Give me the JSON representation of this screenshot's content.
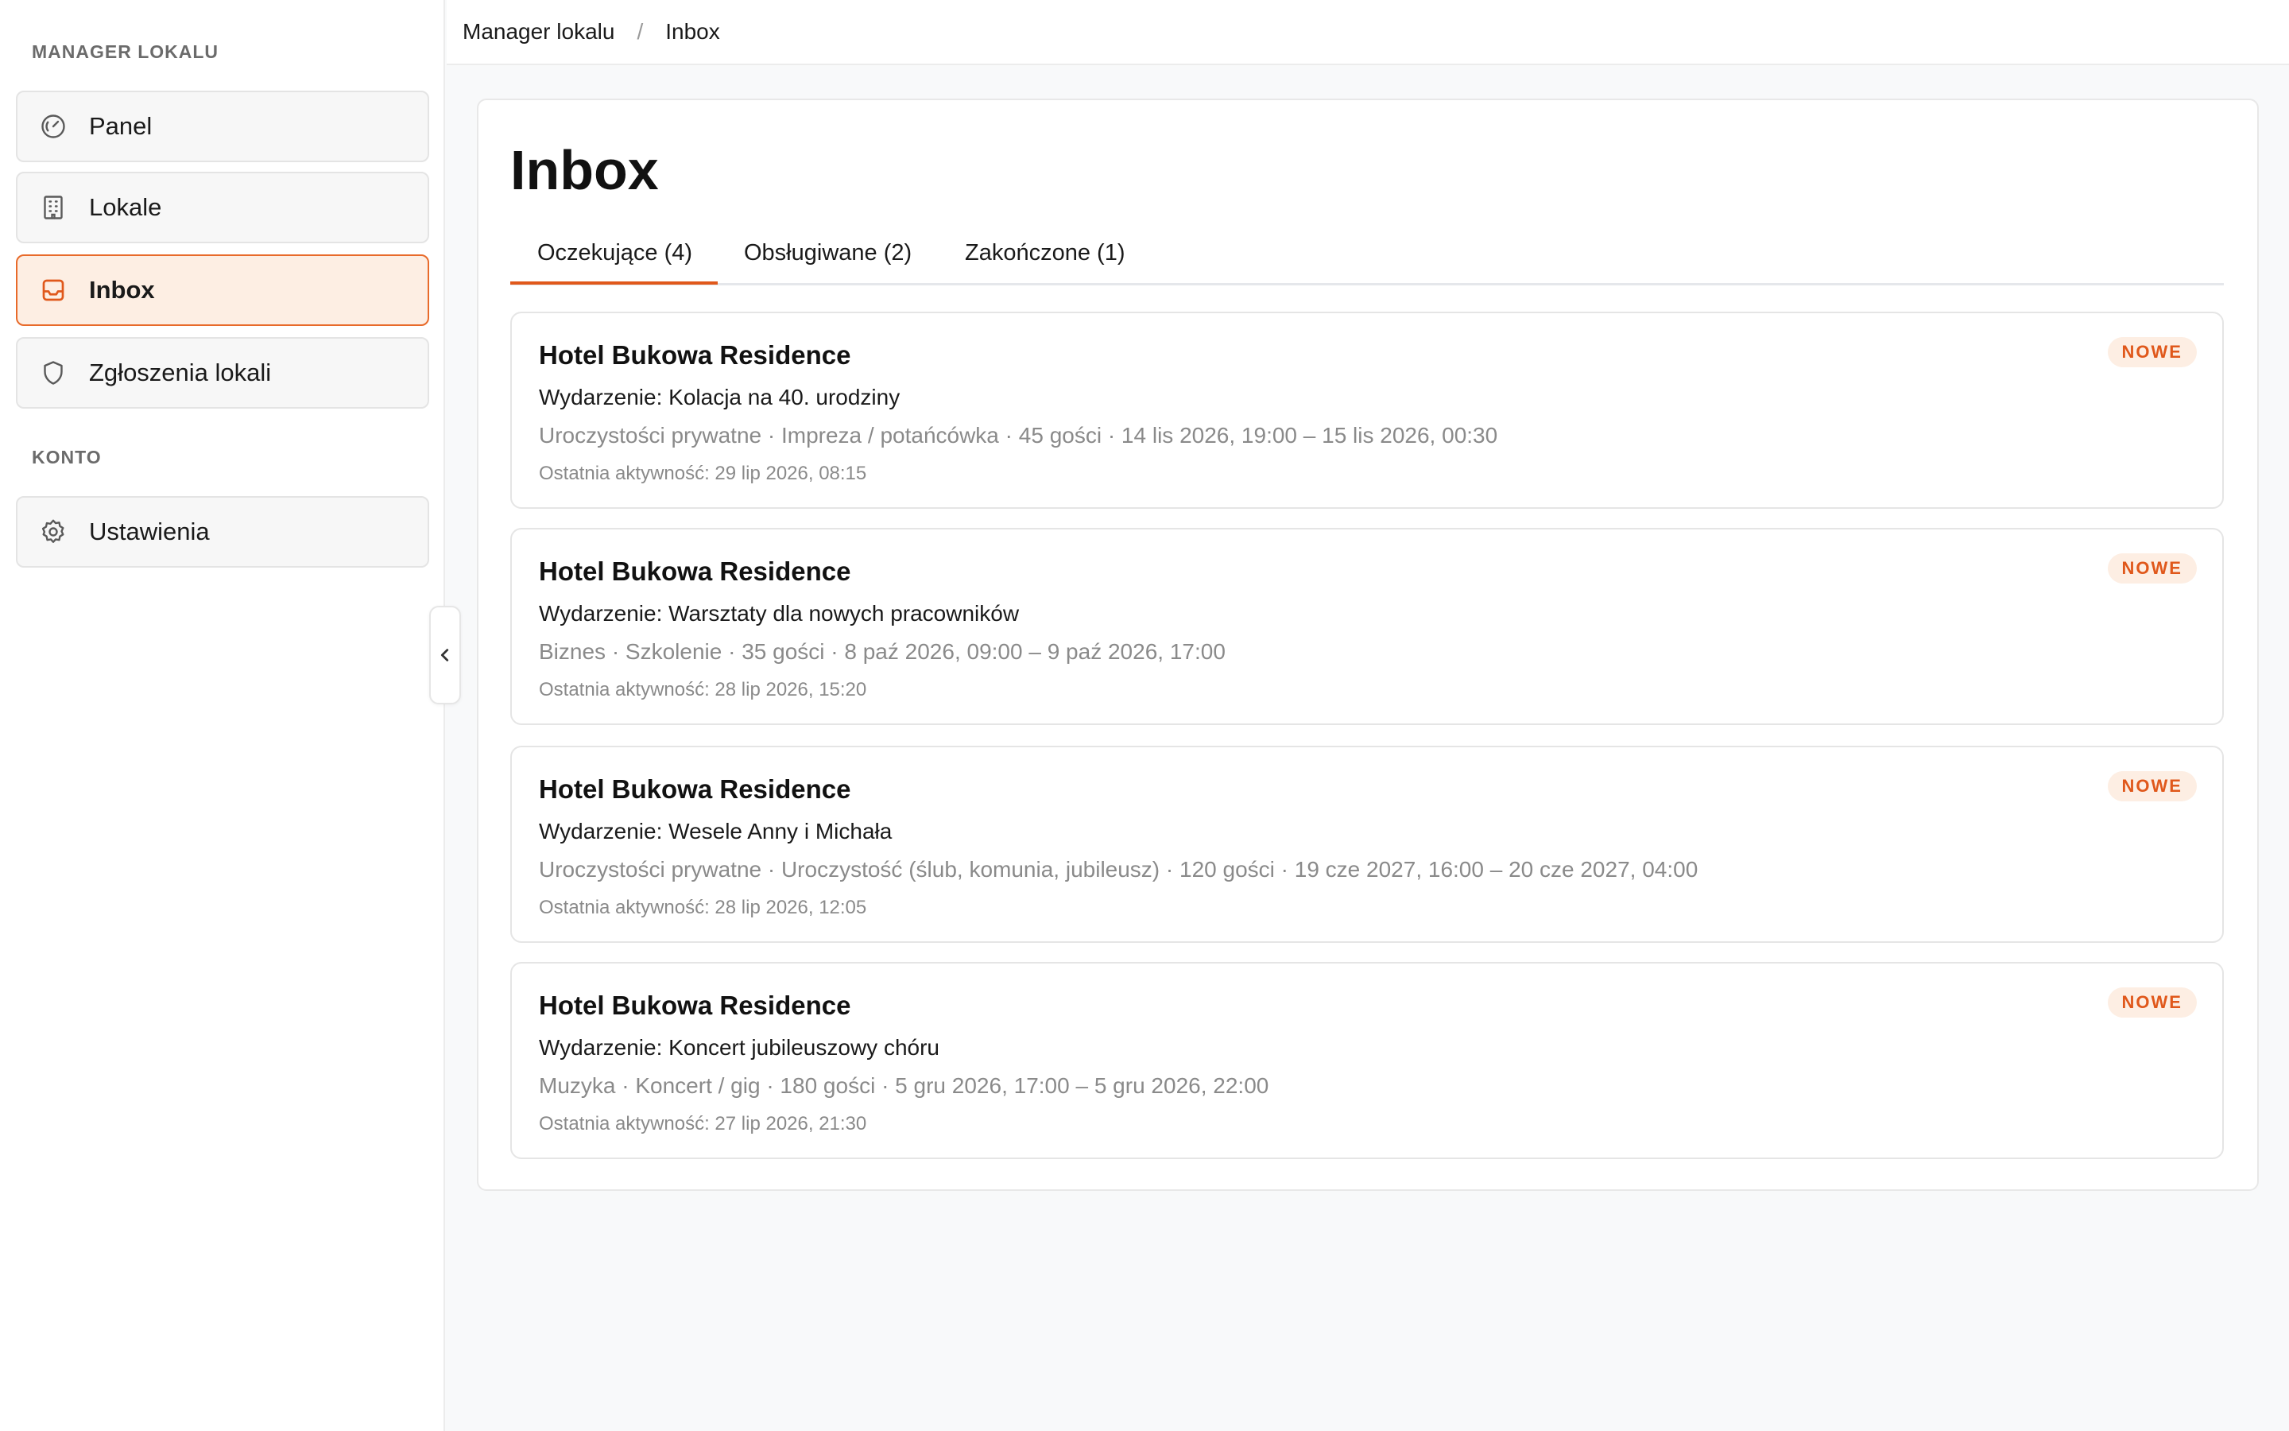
{
  "sidebar": {
    "section_manager": "MANAGER LOKALU",
    "section_account": "KONTO",
    "items": [
      {
        "label": "Panel",
        "icon": "gauge-icon"
      },
      {
        "label": "Lokale",
        "icon": "building-icon"
      },
      {
        "label": "Inbox",
        "icon": "inbox-icon",
        "active": true
      },
      {
        "label": "Zgłoszenia lokali",
        "icon": "shield-icon"
      }
    ],
    "account_items": [
      {
        "label": "Ustawienia",
        "icon": "gear-icon"
      }
    ]
  },
  "breadcrumb": {
    "root": "Manager lokalu",
    "separator": "/",
    "current": "Inbox"
  },
  "page": {
    "title": "Inbox"
  },
  "tabs": [
    {
      "label": "Oczekujące (4)",
      "active": true
    },
    {
      "label": "Obsługiwane (2)",
      "active": false
    },
    {
      "label": "Zakończone (1)",
      "active": false
    }
  ],
  "requests": [
    {
      "venue": "Hotel Bukowa Residence",
      "event": "Wydarzenie: Kolacja na 40. urodziny",
      "details": "Uroczystości prywatne · Impreza / potańcówka · 45 gości · 14 lis 2026, 19:00 – 15 lis 2026, 00:30",
      "activity": "Ostatnia aktywność: 29 lip 2026, 08:15",
      "badge": "NOWE"
    },
    {
      "venue": "Hotel Bukowa Residence",
      "event": "Wydarzenie: Warsztaty dla nowych pracowników",
      "details": "Biznes · Szkolenie · 35 gości · 8 paź 2026, 09:00 – 9 paź 2026, 17:00",
      "activity": "Ostatnia aktywność: 28 lip 2026, 15:20",
      "badge": "NOWE"
    },
    {
      "venue": "Hotel Bukowa Residence",
      "event": "Wydarzenie: Wesele Anny i Michała",
      "details": "Uroczystości prywatne · Uroczystość (ślub, komunia, jubileusz) · 120 gości · 19 cze 2027, 16:00 – 20 cze 2027, 04:00",
      "activity": "Ostatnia aktywność: 28 lip 2026, 12:05",
      "badge": "NOWE"
    },
    {
      "venue": "Hotel Bukowa Residence",
      "event": "Wydarzenie: Koncert jubileuszowy chóru",
      "details": "Muzyka · Koncert / gig · 180 gości · 5 gru 2026, 17:00 – 5 gru 2026, 22:00",
      "activity": "Ostatnia aktywność: 27 lip 2026, 21:30",
      "badge": "NOWE"
    }
  ],
  "colors": {
    "accent": "#e0581b",
    "accent_bg": "#fdeee3"
  }
}
